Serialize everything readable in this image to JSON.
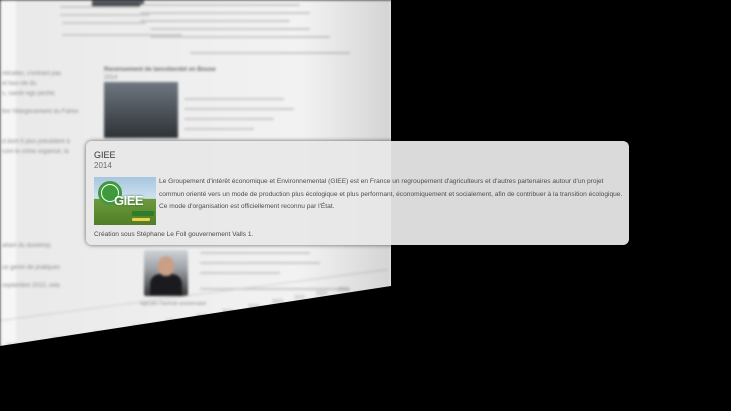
{
  "popup": {
    "title": "GIEE",
    "year": "2014",
    "logo_label": "GIEE",
    "description": "Le Groupement d'intérêt économique et Environnemental (GIEE) est en France un regroupement d'agriculteurs et d'autres partenaires autour d'un projet commun orienté vers un mode de production plus écologique et plus performant, économiquement et socialement, afin de contribuer à la transition écologique. Ce mode d'organisation est officiellement reconnu par l'État.",
    "footer": "Création sous Stéphane Le Foll gouvernement Valls 1."
  },
  "background": {
    "heading": "Recensement de lanceberdet en Bouse",
    "heading_year": "2014",
    "left_fragments": [
      "retraites, s'entrant pas",
      "et bas-vie du",
      "s, savoir ego pechè,",
      "ltre l'élargissement du Fairex",
      "d dont 5 plus précédent à",
      "cont le crime organisé, la",
      "aitant du dureemp.",
      "ce genre de pratiques",
      "septembre 2013, cela"
    ],
    "timeline_ticks": [
      "2012",
      "2013",
      "2014",
      "2015",
      "2016",
      "2017",
      "2018",
      "2019",
      "2020",
      "2021",
      "2022",
      "2023"
    ],
    "photo_caption": "Agiculer l'anécde anniversaire"
  }
}
